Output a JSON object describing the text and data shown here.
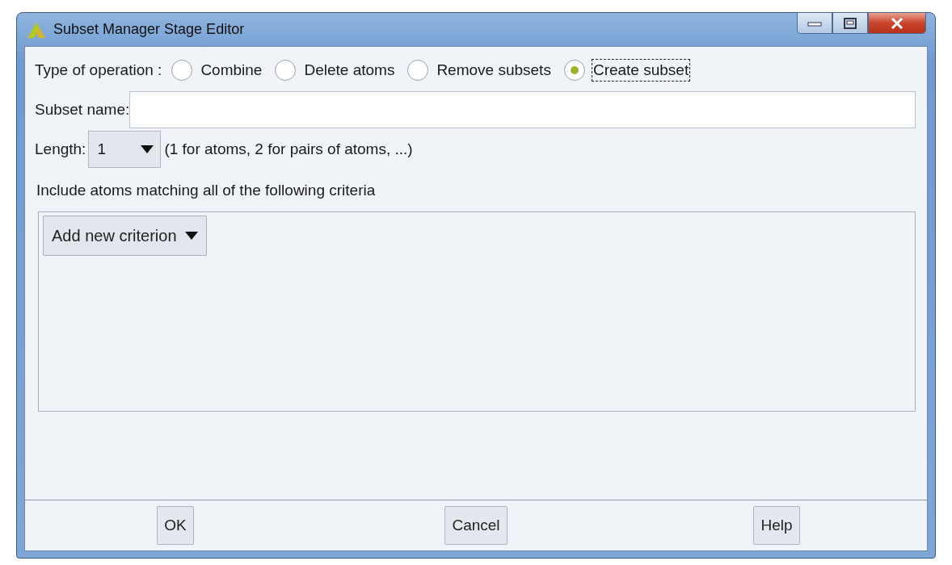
{
  "window": {
    "title": "Subset Manager Stage Editor"
  },
  "operation": {
    "label": "Type of operation :",
    "options": [
      {
        "label": "Combine",
        "selected": false,
        "focused": false
      },
      {
        "label": "Delete atoms",
        "selected": false,
        "focused": false
      },
      {
        "label": "Remove subsets",
        "selected": false,
        "focused": false
      },
      {
        "label": "Create subset",
        "selected": true,
        "focused": true
      }
    ]
  },
  "subset_name": {
    "label": "Subset name:"
  },
  "length": {
    "label": "Length:",
    "value": "1",
    "hint": "(1 for atoms, 2 for pairs of atoms, ...)"
  },
  "criteria": {
    "heading": "Include atoms matching all of the following criteria",
    "add_button": "Add new criterion"
  },
  "buttons": [
    "OK",
    "Cancel",
    "Help"
  ]
}
